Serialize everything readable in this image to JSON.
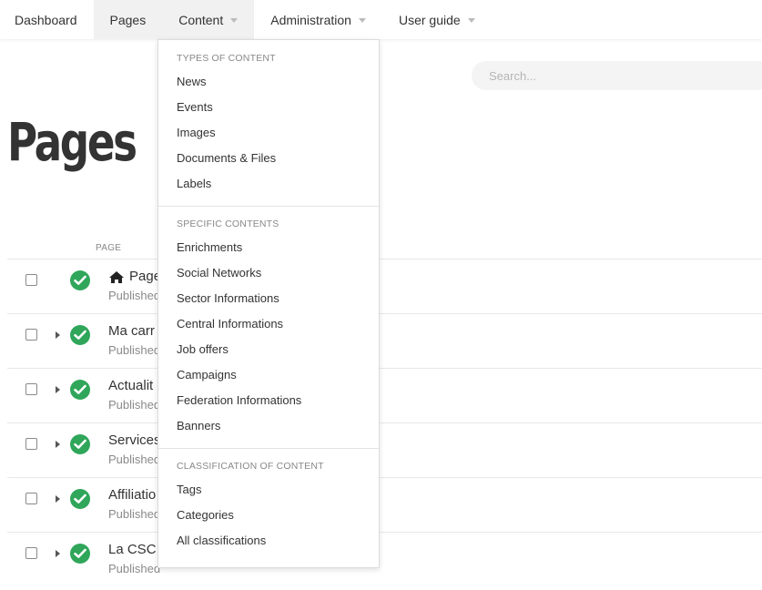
{
  "nav": {
    "items": [
      {
        "label": "Dashboard"
      },
      {
        "label": "Pages"
      },
      {
        "label": "Content"
      },
      {
        "label": "Administration"
      },
      {
        "label": "User guide"
      }
    ]
  },
  "search": {
    "placeholder": "Search..."
  },
  "page": {
    "title": "Pages"
  },
  "table": {
    "column_header": "PAGE",
    "rows": [
      {
        "title": "Page",
        "status": "Published",
        "icon": "home-icon"
      },
      {
        "title": "Ma carr",
        "status": "Published"
      },
      {
        "title": "Actualit",
        "status": "Published"
      },
      {
        "title": "Services",
        "status": "Published"
      },
      {
        "title": "Affiliatio",
        "status": "Published"
      },
      {
        "title": "La CSC",
        "status": "Published"
      }
    ]
  },
  "dropdown": {
    "sections": [
      {
        "heading": "TYPES OF CONTENT",
        "items": [
          "News",
          "Events",
          "Images",
          "Documents & Files",
          "Labels"
        ]
      },
      {
        "heading": "SPECIFIC CONTENTS",
        "items": [
          "Enrichments",
          "Social Networks",
          "Sector Informations",
          "Central Informations",
          "Job offers",
          "Campaigns",
          "Federation Informations",
          "Banners"
        ]
      },
      {
        "heading": "CLASSIFICATION OF CONTENT",
        "items": [
          "Tags",
          "Categories",
          "All classifications"
        ]
      }
    ]
  },
  "colors": {
    "status_green": "#2fa65a",
    "nav_active_bg": "#f1f1f1",
    "text": "#333333"
  }
}
